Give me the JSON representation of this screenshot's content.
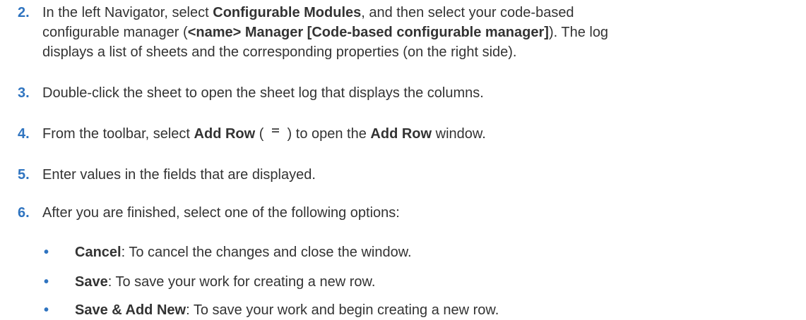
{
  "steps": [
    {
      "number": "2.",
      "line1_pre": "In the left Navigator, select ",
      "line1_bold": "Configurable Modules",
      "line1_post": ", and then select your code-based",
      "line2_pre": "configurable manager (",
      "line2_bold": "<name> Manager [Code-based configurable manager]",
      "line2_post": "). The log",
      "line3": "displays a list of sheets and the corresponding properties (on the right side)."
    },
    {
      "number": "3.",
      "text": "Double-click the sheet to open the sheet log that displays the columns."
    },
    {
      "number": "4.",
      "pre": "From the toolbar, select ",
      "bold1": "Add Row",
      "paren_open": " (",
      "icon": "add-row-icon",
      "paren_close": ") to open the ",
      "bold2": "Add Row",
      "post": " window."
    },
    {
      "number": "5.",
      "text": "Enter values in the fields that are displayed."
    },
    {
      "number": "6.",
      "text": "After you are finished, select one of the following options:"
    }
  ],
  "options": [
    {
      "bullet": "•",
      "label": "Cancel",
      "desc": ": To cancel the changes and close the window."
    },
    {
      "bullet": "•",
      "label": "Save",
      "desc": ": To save your work for creating a new row."
    },
    {
      "bullet": "•",
      "label": "Save & Add New",
      "desc": ": To save your work and begin creating a new row."
    }
  ],
  "colors": {
    "number": "#2f74c0",
    "text": "#333333",
    "background": "#ffffff"
  }
}
